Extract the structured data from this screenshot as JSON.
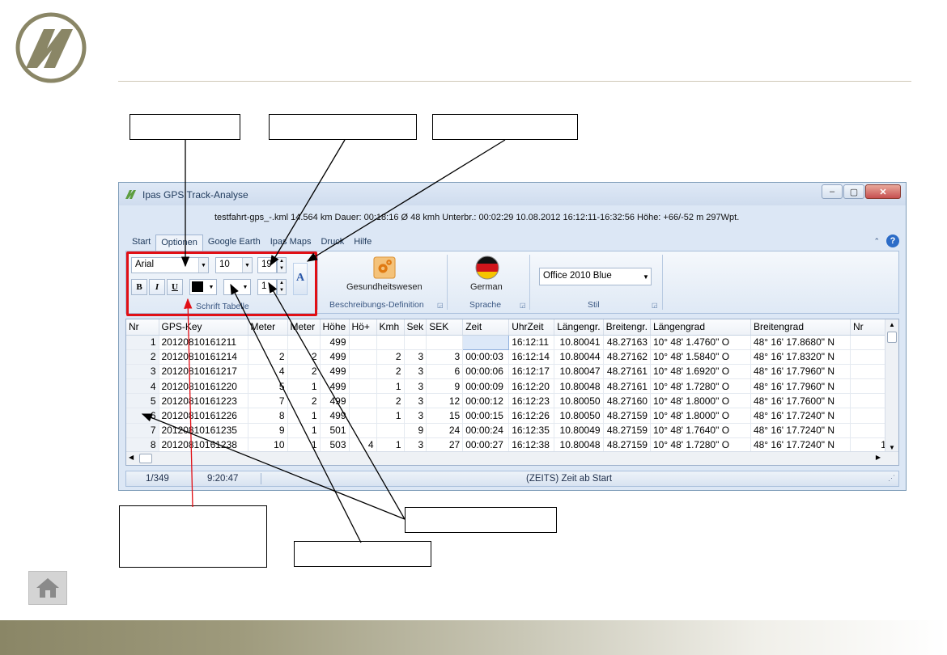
{
  "window": {
    "title": "Ipas GPS Track-Analyse",
    "info_line": "testfahrt-gps_-.kml  14.564 km  Dauer: 00:18:16  Ø 48 kmh  Unterbr.: 00:02:29  10.08.2012 16:12:11-16:32:56   Höhe: +66/-52 m  297Wpt."
  },
  "tabs": [
    {
      "label": "Start"
    },
    {
      "label": "Optionen"
    },
    {
      "label": "Google Earth"
    },
    {
      "label": "Ipas Maps"
    },
    {
      "label": "Druck"
    },
    {
      "label": "Hilfe"
    }
  ],
  "ribbon": {
    "font_name": "Arial",
    "font_size": "10",
    "row_height": "19",
    "line_width": "1",
    "bold": "B",
    "italic": "I",
    "underline": "U",
    "font_icon_letter": "A",
    "group_font": "Schrift Tabelle",
    "button_description": "Gesundheitswesen",
    "group_description": "Beschreibungs-Definition",
    "button_language": "German",
    "group_language": "Sprache",
    "style_value": "Office 2010 Blue",
    "group_style": "Stil"
  },
  "table": {
    "columns": [
      "Nr",
      "GPS-Key",
      "Meter",
      "Meter",
      "Höhe",
      "Hö+",
      "Kmh",
      "Sek",
      "SEK",
      "Zeit",
      "UhrZeit",
      "Längengr.",
      "Breitengr.",
      "Längengrad",
      "Breitengrad",
      "Nr"
    ],
    "rows": [
      [
        "1",
        "20120810161211",
        "",
        "",
        "499",
        "",
        "",
        "",
        "",
        "",
        "16:12:11",
        "10.80041",
        "48.27163",
        "10° 48' 1.4760\" O",
        "48° 16' 17.8680\" N",
        ""
      ],
      [
        "2",
        "20120810161214",
        "2",
        "2",
        "499",
        "",
        "2",
        "3",
        "3",
        "00:00:03",
        "16:12:14",
        "10.80044",
        "48.27162",
        "10° 48' 1.5840\" O",
        "48° 16' 17.8320\" N",
        ""
      ],
      [
        "3",
        "20120810161217",
        "4",
        "2",
        "499",
        "",
        "2",
        "3",
        "6",
        "00:00:06",
        "16:12:17",
        "10.80047",
        "48.27161",
        "10° 48' 1.6920\" O",
        "48° 16' 17.7960\" N",
        ""
      ],
      [
        "4",
        "20120810161220",
        "5",
        "1",
        "499",
        "",
        "1",
        "3",
        "9",
        "00:00:09",
        "16:12:20",
        "10.80048",
        "48.27161",
        "10° 48' 1.7280\" O",
        "48° 16' 17.7960\" N",
        ""
      ],
      [
        "5",
        "20120810161223",
        "7",
        "2",
        "499",
        "",
        "2",
        "3",
        "12",
        "00:00:12",
        "16:12:23",
        "10.80050",
        "48.27160",
        "10° 48' 1.8000\" O",
        "48° 16' 17.7600\" N",
        ""
      ],
      [
        "6",
        "20120810161226",
        "8",
        "1",
        "499",
        "",
        "1",
        "3",
        "15",
        "00:00:15",
        "16:12:26",
        "10.80050",
        "48.27159",
        "10° 48' 1.8000\" O",
        "48° 16' 17.7240\" N",
        ""
      ],
      [
        "7",
        "20120810161235",
        "9",
        "1",
        "501",
        "",
        "",
        "9",
        "24",
        "00:00:24",
        "16:12:35",
        "10.80049",
        "48.27159",
        "10° 48' 1.7640\" O",
        "48° 16' 17.7240\" N",
        ""
      ],
      [
        "8",
        "20120810161238",
        "10",
        "1",
        "503",
        "4",
        "1",
        "3",
        "27",
        "00:00:27",
        "16:12:38",
        "10.80048",
        "48.27159",
        "10° 48' 1.7280\" O",
        "48° 16' 17.7240\" N",
        "1"
      ]
    ]
  },
  "status": {
    "position": "1/349",
    "time": "9:20:47",
    "hint": "(ZEITS)  Zeit ab Start"
  },
  "colors": {
    "highlight_frame": "#e10f15",
    "ribbon_blue": "#dce7f5"
  },
  "icons": {
    "home": "home-icon",
    "logo": "logo-icon"
  }
}
